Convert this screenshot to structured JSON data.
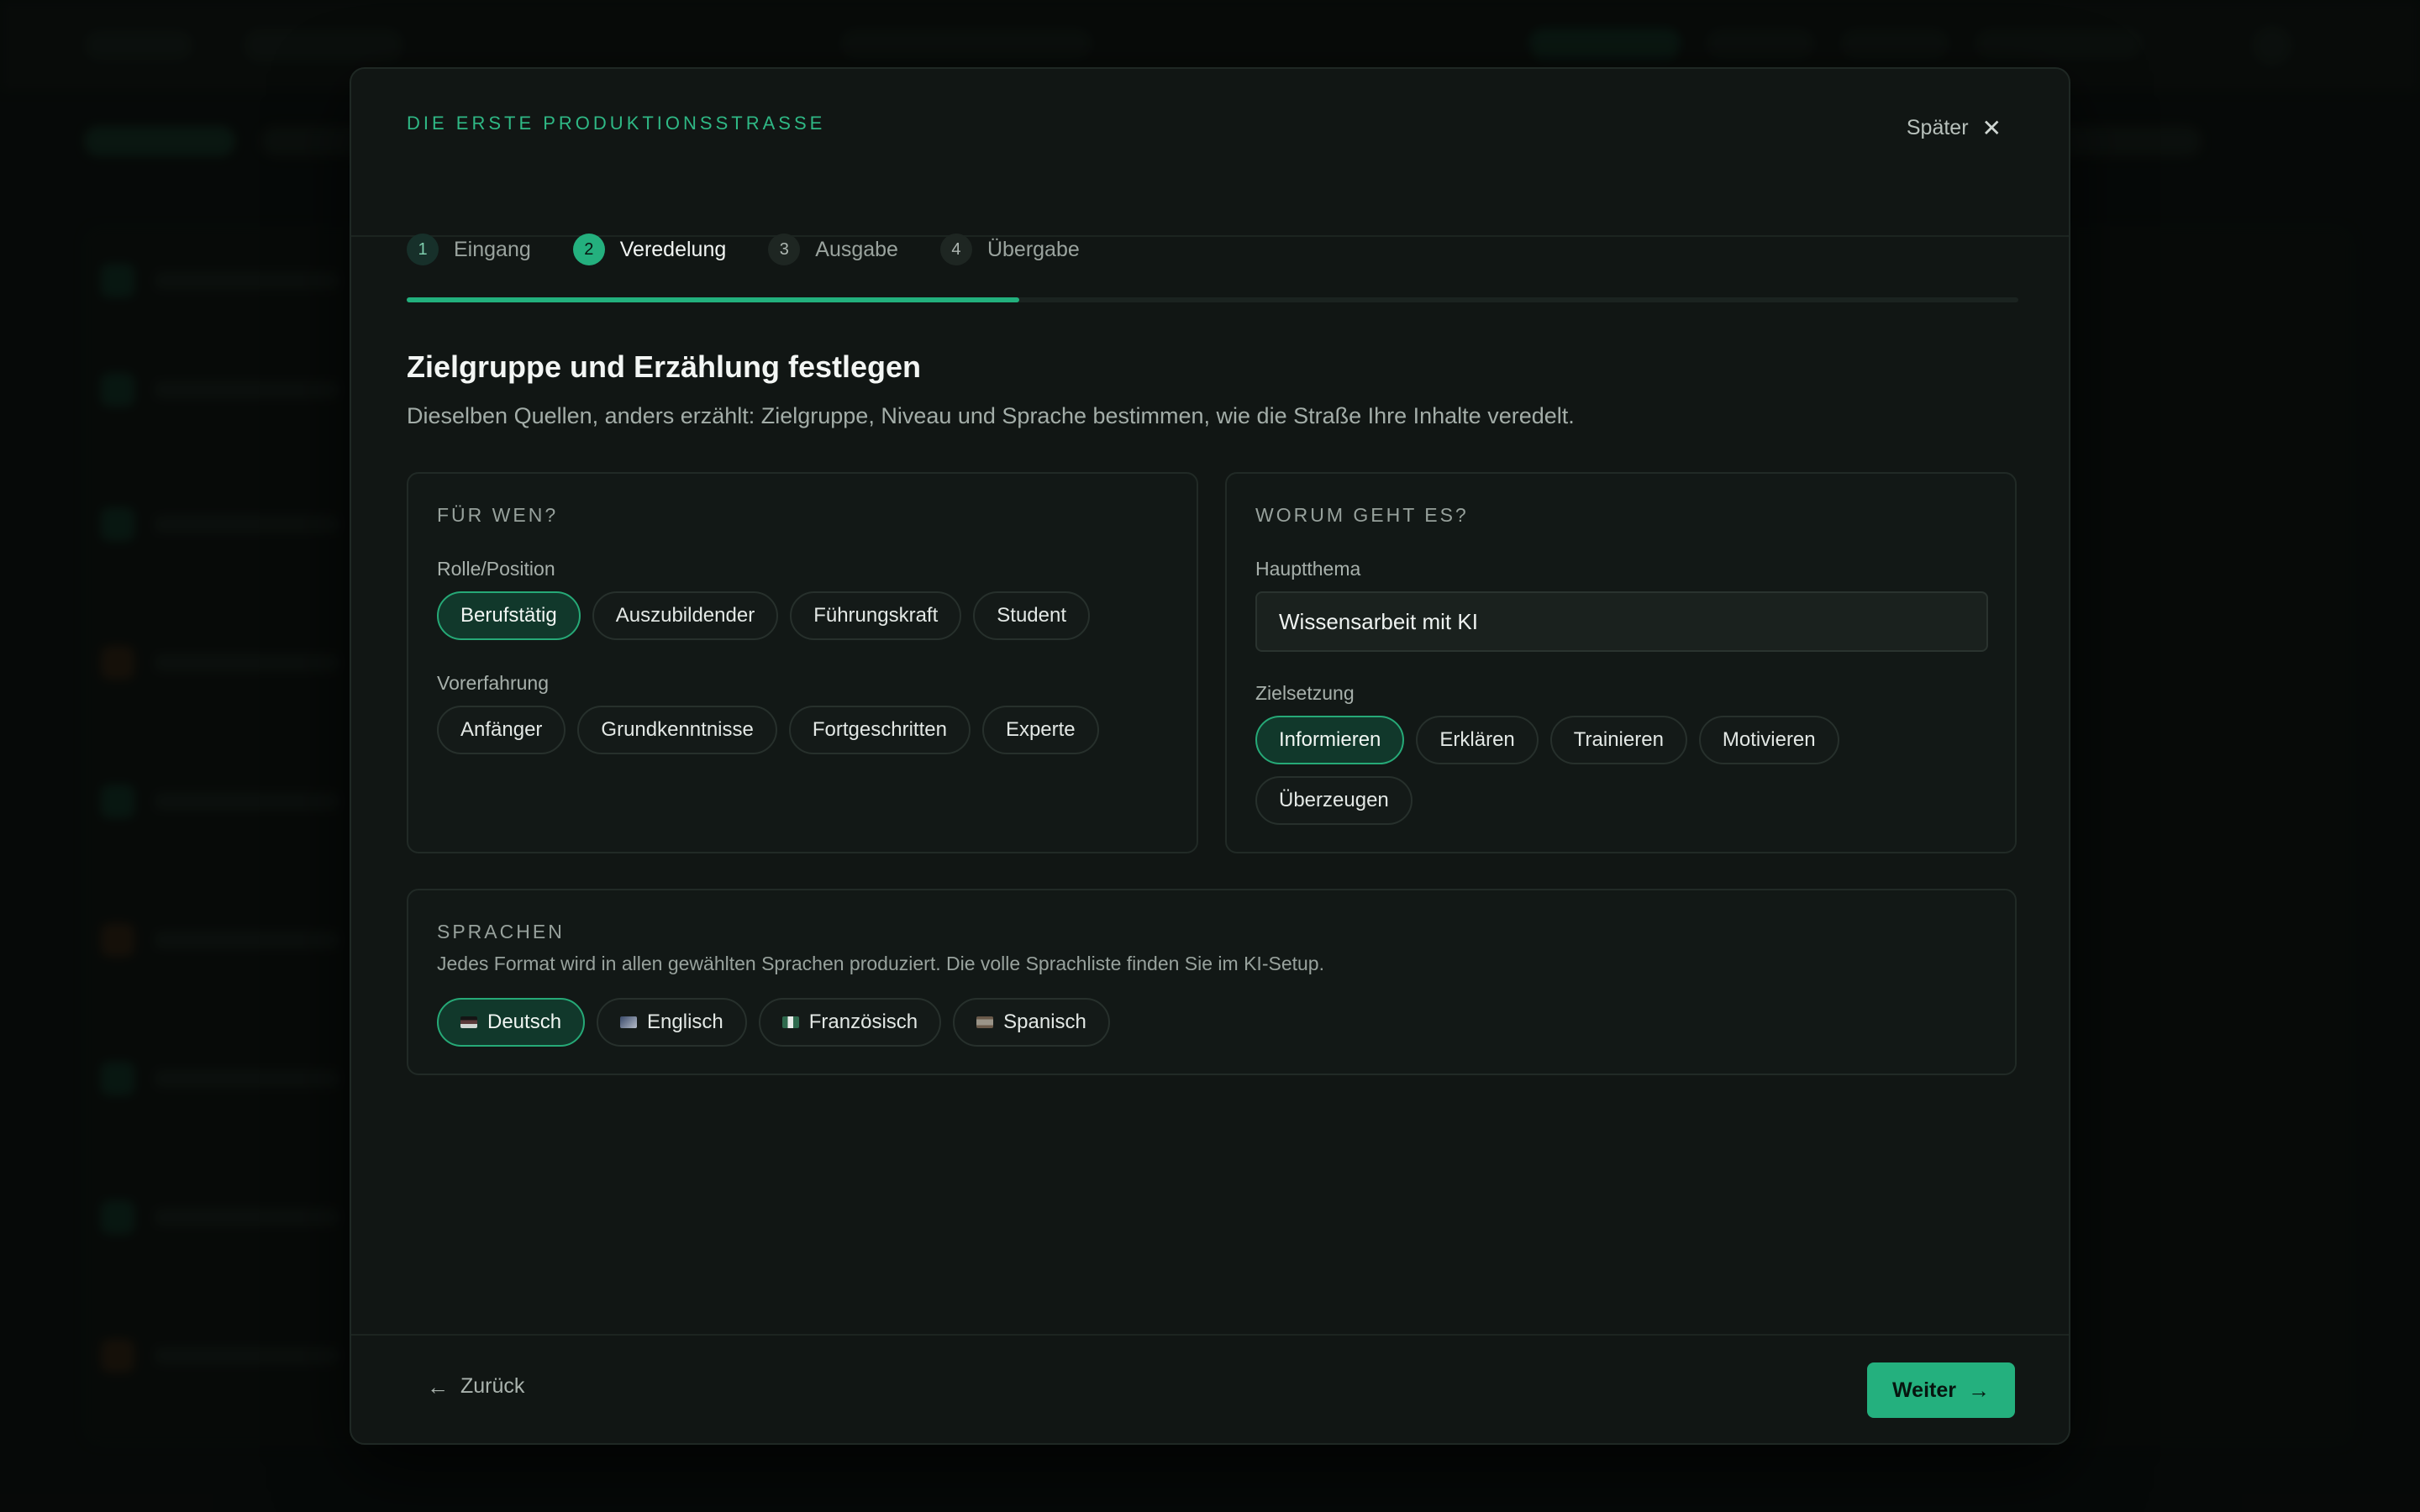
{
  "modal": {
    "eyebrow": "DIE ERSTE PRODUKTIONSSTRASSE",
    "later_label": "Später",
    "close_icon": "close-icon",
    "steps": [
      {
        "num": "1",
        "label": "Eingang",
        "state": "done"
      },
      {
        "num": "2",
        "label": "Veredelung",
        "state": "active"
      },
      {
        "num": "3",
        "label": "Ausgabe",
        "state": "upcoming"
      },
      {
        "num": "4",
        "label": "Übergabe",
        "state": "upcoming"
      }
    ],
    "progress_fraction": 0.38
  },
  "content": {
    "title": "Zielgruppe und Erzählung festlegen",
    "description": "Dieselben Quellen, anders erzählt: Zielgruppe, Niveau und Sprache bestimmen, wie die Straße Ihre Inhalte veredelt."
  },
  "audience_card": {
    "heading": "FÜR WEN?",
    "role_label": "Rolle/Position",
    "roles": [
      {
        "label": "Berufstätig",
        "selected": true
      },
      {
        "label": "Auszubildender",
        "selected": false
      },
      {
        "label": "Führungskraft",
        "selected": false
      },
      {
        "label": "Student",
        "selected": false
      }
    ],
    "experience_label": "Vorerfahrung",
    "experience": [
      {
        "label": "Anfänger",
        "selected": false
      },
      {
        "label": "Grundkenntnisse",
        "selected": false
      },
      {
        "label": "Fortgeschritten",
        "selected": false
      },
      {
        "label": "Experte",
        "selected": false
      }
    ]
  },
  "topic_card": {
    "heading": "WORUM GEHT ES?",
    "topic_label": "Hauptthema",
    "topic_value": "Wissensarbeit mit KI",
    "goal_label": "Zielsetzung",
    "goals": [
      {
        "label": "Informieren",
        "selected": true
      },
      {
        "label": "Erklären",
        "selected": false
      },
      {
        "label": "Trainieren",
        "selected": false
      },
      {
        "label": "Motivieren",
        "selected": false
      },
      {
        "label": "Überzeugen",
        "selected": false
      }
    ]
  },
  "languages_card": {
    "heading": "SPRACHEN",
    "note": "Jedes Format wird in allen gewählten Sprachen produziert. Die volle Sprachliste finden Sie im KI-Setup.",
    "languages": [
      {
        "label": "Deutsch",
        "flag": "flag-de",
        "selected": true
      },
      {
        "label": "Englisch",
        "flag": "flag-en",
        "selected": false
      },
      {
        "label": "Französisch",
        "flag": "flag-fr",
        "selected": false
      },
      {
        "label": "Spanisch",
        "flag": "flag-es",
        "selected": false
      }
    ]
  },
  "footer": {
    "back_label": "Zurück",
    "next_label": "Weiter",
    "back_icon": "arrow-left-icon",
    "next_icon": "arrow-right-icon"
  },
  "colors": {
    "accent": "#24b07e",
    "background": "#090c0b",
    "modal": "#111614"
  }
}
